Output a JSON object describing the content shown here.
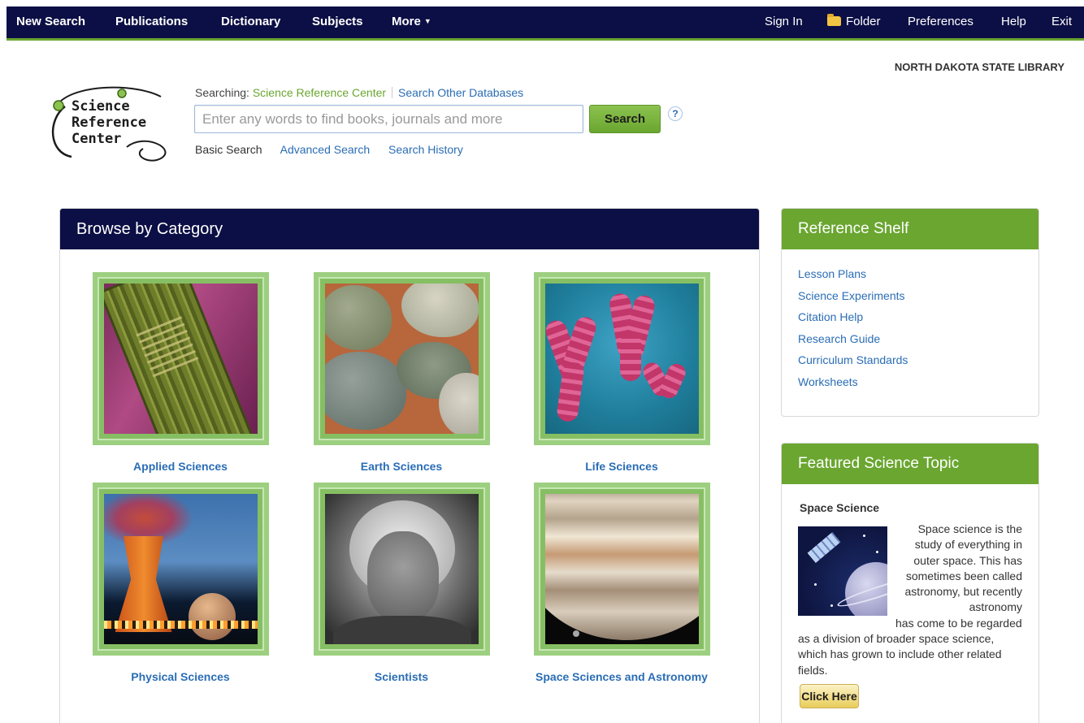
{
  "nav": {
    "left": [
      "New Search",
      "Publications",
      "Dictionary",
      "Subjects",
      "More"
    ],
    "right": [
      "Sign In",
      "Folder",
      "Preferences",
      "Help",
      "Exit"
    ]
  },
  "institution": "NORTH DAKOTA STATE LIBRARY",
  "logo": {
    "line1": "Science",
    "line2": "Reference",
    "line3": "Center"
  },
  "search": {
    "searching_label": "Searching:",
    "database": "Science Reference Center",
    "other_databases": "Search Other Databases",
    "placeholder": "Enter any words to find books, journals and more",
    "button": "Search",
    "help": "?",
    "links": [
      "Basic Search",
      "Advanced Search",
      "Search History"
    ]
  },
  "browse": {
    "title": "Browse by Category",
    "categories": [
      "Applied Sciences",
      "Earth Sciences",
      "Life Sciences",
      "Physical Sciences",
      "Scientists",
      "Space Sciences and Astronomy"
    ]
  },
  "reference_shelf": {
    "title": "Reference Shelf",
    "items": [
      "Lesson Plans",
      "Science Experiments",
      "Citation Help",
      "Research Guide",
      "Curriculum Standards",
      "Worksheets"
    ]
  },
  "featured": {
    "title": "Featured Science Topic",
    "topic": "Space Science",
    "text_wrapped": "Space science is the study of everything in outer space. This has sometimes been called astronomy, but recently astronomy",
    "text_continued": "has come to be regarded as a division of broader space science, which has grown to include other related fields.",
    "button": "Click Here"
  },
  "colors": {
    "navy": "#0c0f45",
    "green": "#6aa630",
    "link": "#2a6db5"
  }
}
